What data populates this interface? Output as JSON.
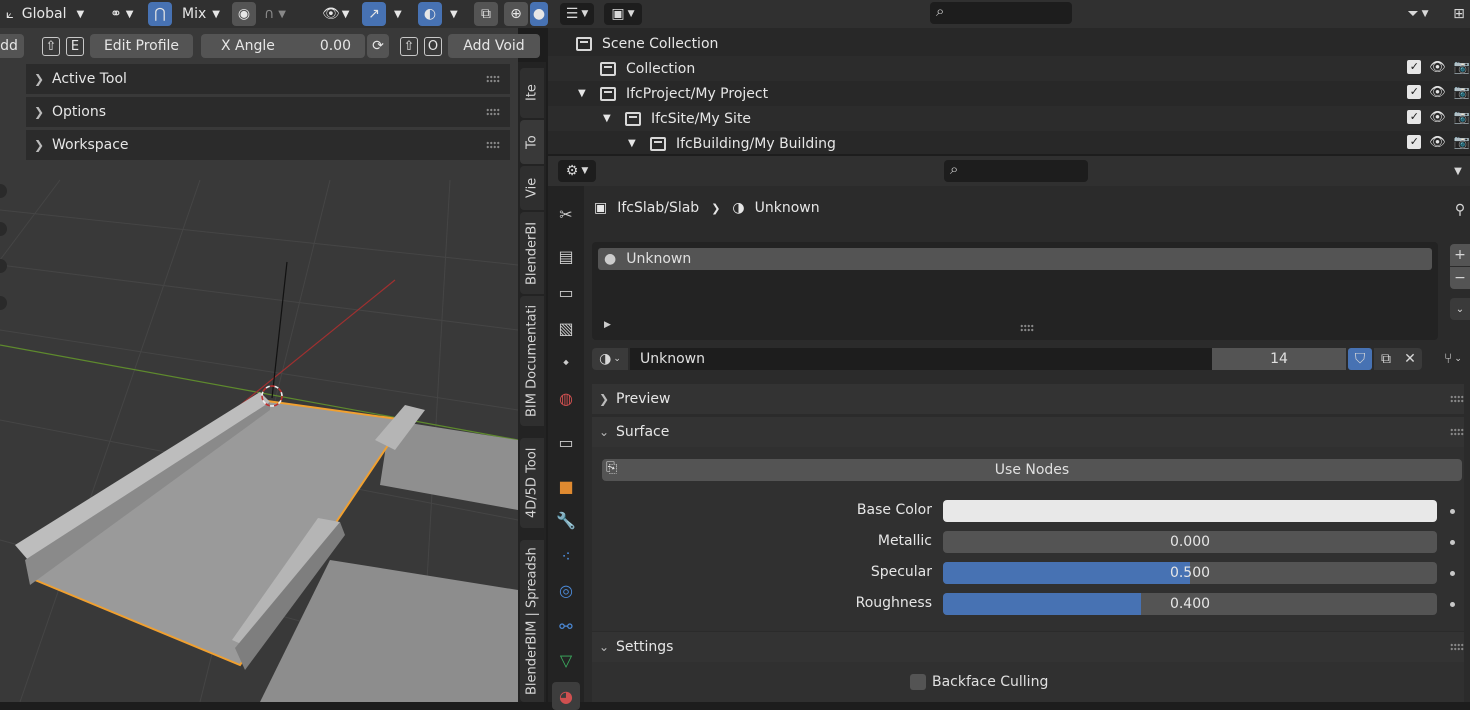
{
  "viewport_header": {
    "orientation": "Global",
    "snap_mode": "Mix"
  },
  "tool_header": {
    "add_label": "dd",
    "key_shift": "⇧",
    "key_e": "E",
    "edit_profile": "Edit Profile",
    "x_angle_label": "X Angle",
    "x_angle_value": "0.00",
    "key_o": "O",
    "add_void": "Add Void"
  },
  "npanels": [
    "Active Tool",
    "Options",
    "Workspace"
  ],
  "side_tabs": [
    "Ite",
    "To",
    "Vie",
    "BlenderBI",
    "BIM Documentati",
    "4D/5D Tool",
    "BlenderBIM | Spreadsh"
  ],
  "outliner": {
    "rows": [
      {
        "label": "Scene Collection"
      },
      {
        "label": "Collection"
      },
      {
        "label": "IfcProject/My Project"
      },
      {
        "label": "IfcSite/My Site"
      },
      {
        "label": "IfcBuilding/My Building"
      }
    ]
  },
  "properties": {
    "breadcrumb_object": "IfcSlab/Slab",
    "breadcrumb_material": "Unknown",
    "slot_name": "Unknown",
    "material_name": "Unknown",
    "user_count": "14",
    "panels": {
      "preview": "Preview",
      "surface": "Surface",
      "settings": "Settings"
    },
    "use_nodes": "Use Nodes",
    "fields": [
      {
        "label": "Base Color",
        "value": "",
        "fill": 0
      },
      {
        "label": "Metallic",
        "value": "0.000",
        "fill": 0
      },
      {
        "label": "Specular",
        "value": "0.500",
        "fill": 0.5
      },
      {
        "label": "Roughness",
        "value": "0.400",
        "fill": 0.4
      }
    ],
    "backface_culling": "Backface Culling"
  },
  "colors": {
    "accent": "#4772b3",
    "selection_outline": "#f0a030",
    "base_color": "#e8e8e8"
  }
}
